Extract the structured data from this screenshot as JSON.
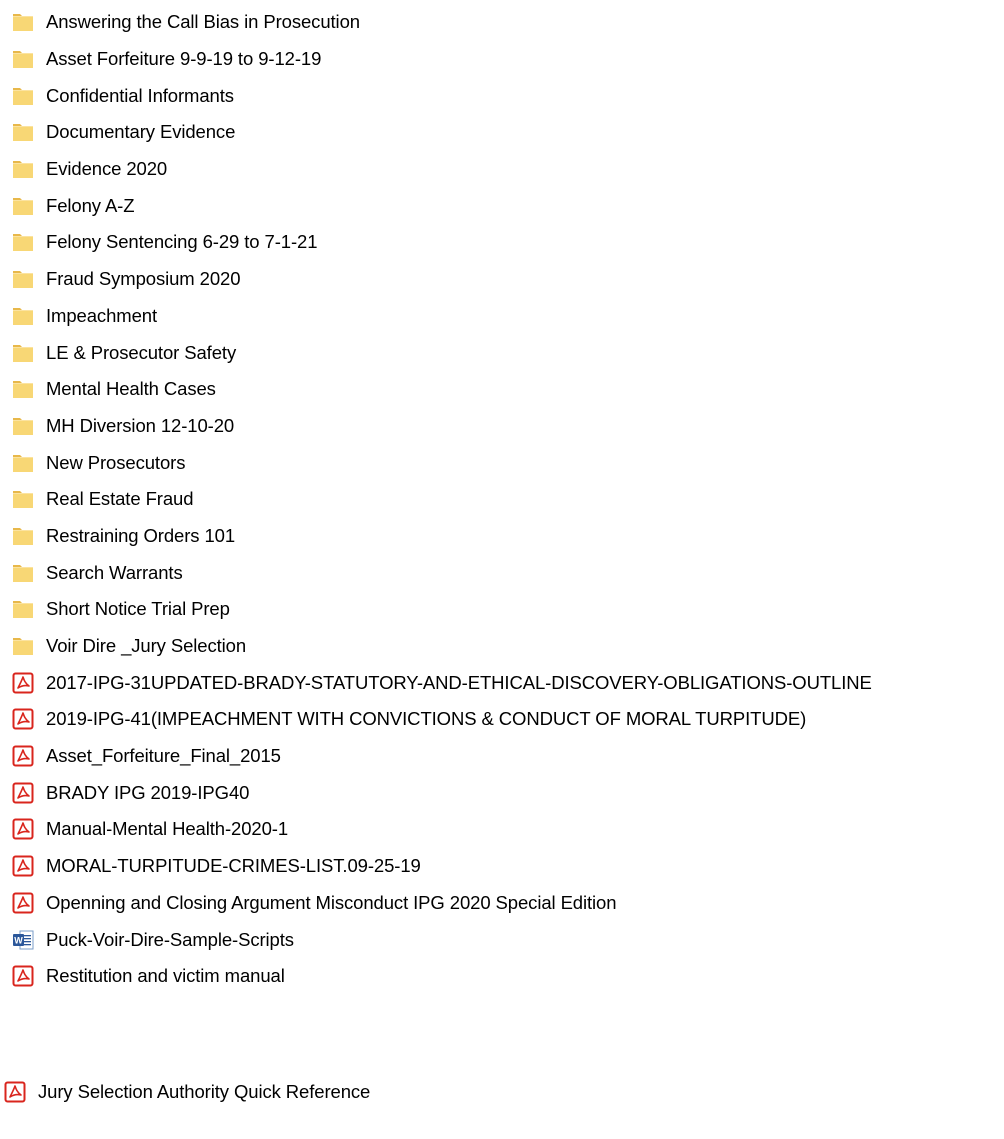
{
  "items": [
    {
      "type": "folder",
      "label": "Answering the Call Bias in Prosecution"
    },
    {
      "type": "folder",
      "label": "Asset Forfeiture 9-9-19 to 9-12-19"
    },
    {
      "type": "folder",
      "label": "Confidential Informants"
    },
    {
      "type": "folder",
      "label": "Documentary Evidence"
    },
    {
      "type": "folder",
      "label": "Evidence 2020"
    },
    {
      "type": "folder",
      "label": "Felony A-Z"
    },
    {
      "type": "folder",
      "label": "Felony Sentencing 6-29 to 7-1-21"
    },
    {
      "type": "folder",
      "label": "Fraud Symposium 2020"
    },
    {
      "type": "folder",
      "label": "Impeachment"
    },
    {
      "type": "folder",
      "label": "LE & Prosecutor Safety"
    },
    {
      "type": "folder",
      "label": "Mental Health Cases"
    },
    {
      "type": "folder",
      "label": "MH Diversion 12-10-20"
    },
    {
      "type": "folder",
      "label": "New Prosecutors"
    },
    {
      "type": "folder",
      "label": "Real Estate Fraud"
    },
    {
      "type": "folder",
      "label": "Restraining Orders 101"
    },
    {
      "type": "folder",
      "label": "Search Warrants"
    },
    {
      "type": "folder",
      "label": "Short Notice Trial Prep"
    },
    {
      "type": "folder",
      "label": "Voir Dire _Jury Selection"
    },
    {
      "type": "pdf",
      "label": "2017-IPG-31UPDATED-BRADY-STATUTORY-AND-ETHICAL-DISCOVERY-OBLIGATIONS-OUTLINE"
    },
    {
      "type": "pdf",
      "label": "2019-IPG-41(IMPEACHMENT WITH CONVICTIONS & CONDUCT OF MORAL TURPITUDE)"
    },
    {
      "type": "pdf",
      "label": "Asset_Forfeiture_Final_2015"
    },
    {
      "type": "pdf",
      "label": "BRADY IPG   2019-IPG40"
    },
    {
      "type": "pdf",
      "label": "Manual-Mental Health-2020-1"
    },
    {
      "type": "pdf",
      "label": "MORAL-TURPITUDE-CRIMES-LIST.09-25-19"
    },
    {
      "type": "pdf",
      "label": "Openning and Closing Argument Misconduct  IPG 2020 Special Edition"
    },
    {
      "type": "word",
      "label": "Puck-Voir-Dire-Sample-Scripts"
    },
    {
      "type": "pdf",
      "label": "Restitution and victim manual"
    }
  ],
  "standalone_item": {
    "type": "pdf",
    "label": "Jury Selection Authority Quick Reference"
  },
  "icons": {
    "folder": "folder-icon",
    "pdf": "pdf-icon",
    "word": "word-document-icon"
  },
  "colors": {
    "folder_body": "#F8D775",
    "folder_tab": "#E8B84A",
    "pdf_red": "#D9251D",
    "word_blue": "#2B579A",
    "text": "#000000"
  }
}
